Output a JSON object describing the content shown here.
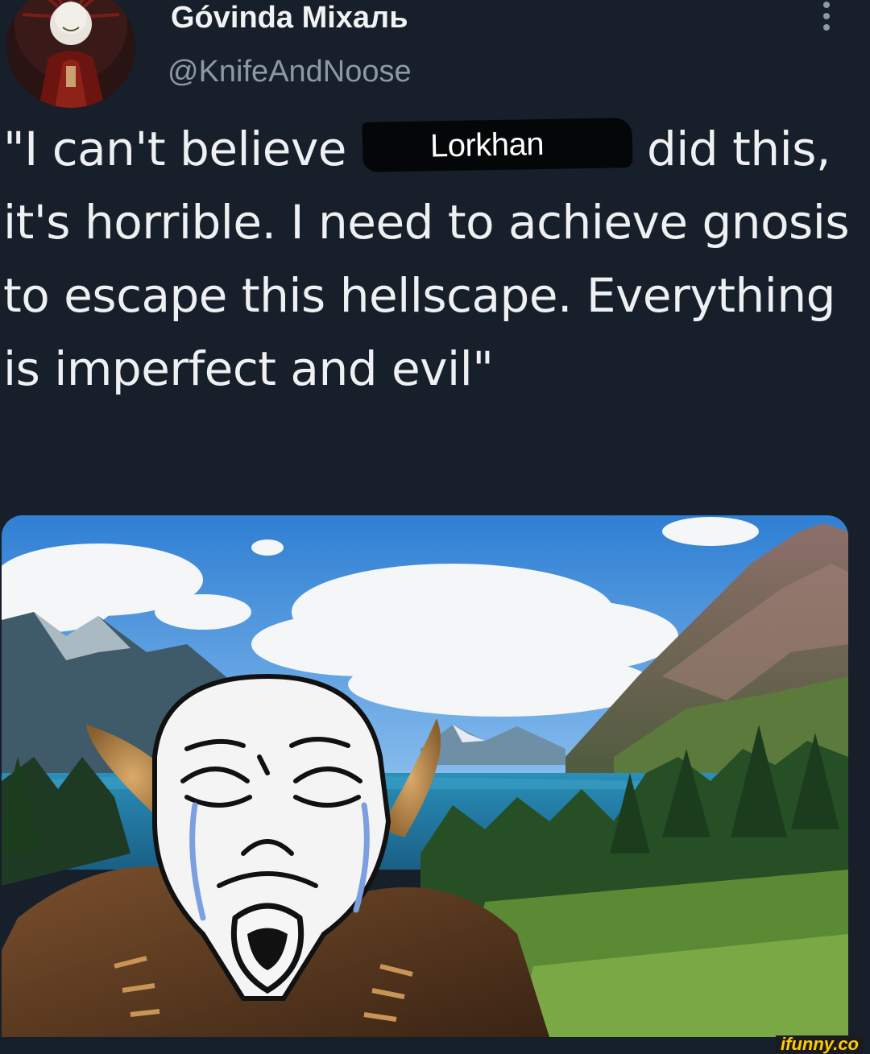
{
  "tweet": {
    "display_name": "Góvinda Міхаль",
    "handle": "@KnifeAndNoose",
    "text_before": "\"I can't believe",
    "censored_label": "Lorkhan",
    "text_after": "did this, it's horrible. I need to achieve gnosis to escape this hellscape. Everything is imperfect and evil\""
  },
  "watermark": "ifunny.co",
  "icons": {
    "more": "more-vertical-icon"
  }
}
